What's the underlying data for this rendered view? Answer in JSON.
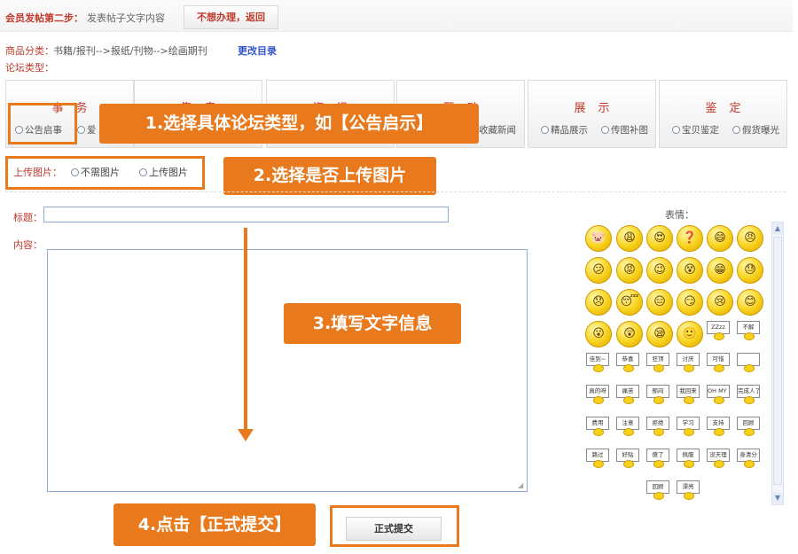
{
  "header": {
    "step_title": "会员发帖第二步：",
    "step_desc": "发表帖子文字内容",
    "back_button": "不想办理，返回"
  },
  "category": {
    "label": "商品分类：",
    "value": "书籍/报刊-->报纸/刊物-->绘画期刊",
    "change_link": "更改目录",
    "forum_type_label": "论坛类型："
  },
  "tabs": [
    {
      "head": "事务",
      "options": [
        "公告启事",
        "爱"
      ]
    },
    {
      "head": "售卖",
      "options": []
    },
    {
      "head": "资讯",
      "options": []
    },
    {
      "head": "互动",
      "options": [
        "收藏新闻"
      ]
    },
    {
      "head": "展示",
      "options": [
        "精品展示",
        "传图补图"
      ]
    },
    {
      "head": "鉴定",
      "options": [
        "宝贝鉴定",
        "假货曝光"
      ]
    }
  ],
  "upload": {
    "label": "上传图片：",
    "option_no": "不需图片",
    "option_yes": "上传图片"
  },
  "form": {
    "title_label": "标题：",
    "content_label": "内容：",
    "submit": "正式提交"
  },
  "emoticons": {
    "label": "表情：",
    "signs": [
      "佳到~",
      "恭喜",
      "狂顶",
      "讨厌",
      "可惜",
      "",
      "真的呀",
      "痛苦",
      "郁闷",
      "我回来",
      "OH MY GOD!",
      "完成人了",
      "费用",
      "注意",
      "拒绝",
      "学习",
      "支持",
      "回顾",
      "路过",
      "好贴",
      "傻了",
      "佩服",
      "没天理",
      "身清分",
      "回顾",
      "漂亮"
    ],
    "sign_zz": "ZZzz",
    "sign_no": "不解"
  },
  "callouts": {
    "step1": "1.选择具体论坛类型，如【公告启示】",
    "step2": "2.选择是否上传图片",
    "step3": "3.填写文字信息",
    "step4": "4.点击【正式提交】"
  },
  "colors": {
    "accent": "#e8791c",
    "label_red": "#c0392b",
    "link_blue": "#3355cc"
  }
}
